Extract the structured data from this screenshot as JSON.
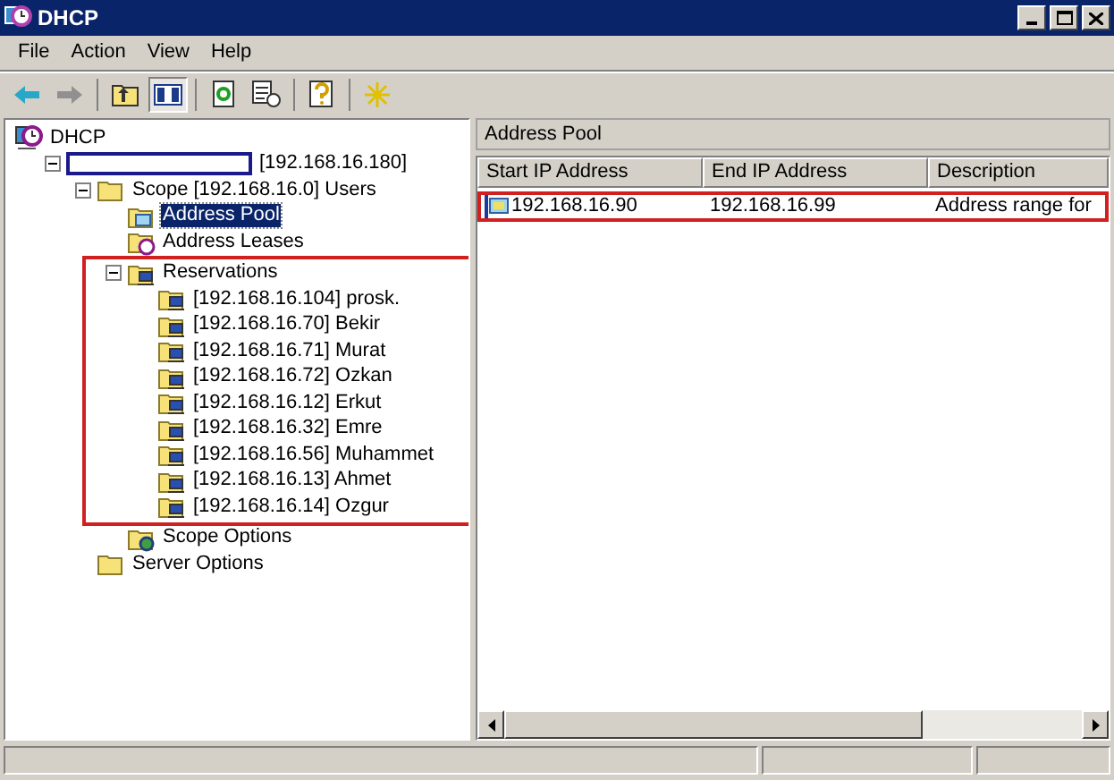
{
  "window": {
    "title": "DHCP"
  },
  "menu": [
    "File",
    "Action",
    "View",
    "Help"
  ],
  "tree": [
    {
      "label": "DHCP",
      "kind": "dhcp",
      "selected": false,
      "children": [
        {
          "label": "[192.168.16.180]",
          "redacted": true,
          "expanded": true,
          "selected": false,
          "children": [
            {
              "label": "Scope [192.168.16.0] Users",
              "kind": "folder",
              "expanded": true,
              "selected": false,
              "children": [
                {
                  "label": "Address Pool",
                  "kind": "pool",
                  "selected": true
                },
                {
                  "label": "Address Leases",
                  "kind": "leases",
                  "selected": false
                },
                {
                  "label": "Reservations",
                  "kind": "reservations",
                  "expanded": true,
                  "selected": false,
                  "highlighted": true,
                  "children": [
                    {
                      "label": "[192.168.16.104] prosk.",
                      "kind": "reservation",
                      "selected": false
                    },
                    {
                      "label": "[192.168.16.70] Bekir",
                      "kind": "reservation",
                      "selected": false
                    },
                    {
                      "label": "[192.168.16.71] Murat",
                      "kind": "reservation",
                      "selected": false
                    },
                    {
                      "label": "[192.168.16.72] Ozkan",
                      "kind": "reservation",
                      "selected": false
                    },
                    {
                      "label": "[192.168.16.12] Erkut",
                      "kind": "reservation",
                      "selected": false
                    },
                    {
                      "label": "[192.168.16.32] Emre",
                      "kind": "reservation",
                      "selected": false
                    },
                    {
                      "label": "[192.168.16.56] Muhammet",
                      "kind": "reservation",
                      "selected": false
                    },
                    {
                      "label": "[192.168.16.13] Ahmet",
                      "kind": "reservation",
                      "selected": false
                    },
                    {
                      "label": "[192.168.16.14] Ozgur",
                      "kind": "reservation",
                      "selected": false
                    }
                  ]
                },
                {
                  "label": "Scope Options",
                  "kind": "options",
                  "selected": false
                }
              ]
            },
            {
              "label": "Server Options",
              "kind": "folder",
              "selected": false
            }
          ]
        }
      ]
    }
  ],
  "detail": {
    "title": "Address Pool",
    "columns": [
      "Start IP Address",
      "End IP Address",
      "Description"
    ],
    "rows": [
      {
        "cells": [
          "192.168.16.90",
          "192.168.16.99",
          "Address range for"
        ],
        "highlighted": true
      }
    ]
  }
}
